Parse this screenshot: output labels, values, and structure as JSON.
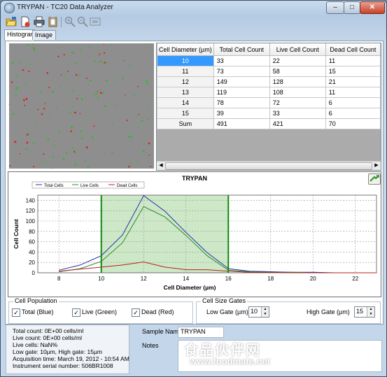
{
  "window": {
    "title": "TRYPAN - TC20 Data Analyzer"
  },
  "tabs": [
    {
      "label": "Histogram"
    },
    {
      "label": "Image"
    }
  ],
  "table": {
    "headers": [
      "Cell Diameter (µm)",
      "Total Cell Count",
      "Live Cell Count",
      "Dead Cell Count"
    ],
    "rows": [
      [
        "10",
        "33",
        "22",
        "11"
      ],
      [
        "11",
        "73",
        "58",
        "15"
      ],
      [
        "12",
        "149",
        "128",
        "21"
      ],
      [
        "13",
        "119",
        "108",
        "11"
      ],
      [
        "14",
        "78",
        "72",
        "6"
      ],
      [
        "15",
        "39",
        "33",
        "6"
      ],
      [
        "Sum",
        "491",
        "421",
        "70"
      ]
    ]
  },
  "chart_data": {
    "type": "line",
    "title": "TRYPAN",
    "xlabel": "Cell Diameter (µm)",
    "ylabel": "Cell Count",
    "xlim": [
      7,
      23
    ],
    "ylim": [
      0,
      150
    ],
    "xticks": [
      8,
      10,
      12,
      14,
      16,
      18,
      20,
      22
    ],
    "yticks": [
      0,
      20,
      40,
      60,
      80,
      100,
      120,
      140
    ],
    "x": [
      8,
      9,
      10,
      11,
      12,
      13,
      14,
      15,
      16,
      17,
      18,
      19,
      20,
      21,
      22,
      23
    ],
    "series": [
      {
        "name": "Total Cells",
        "color": "#1f2fa8",
        "values": [
          5,
          15,
          33,
          73,
          149,
          119,
          78,
          39,
          8,
          3,
          2,
          1,
          1,
          0,
          0,
          0
        ]
      },
      {
        "name": "Live Cells",
        "color": "#2b8a2b",
        "values": [
          2,
          8,
          22,
          58,
          128,
          108,
          72,
          33,
          5,
          2,
          1,
          1,
          0,
          0,
          0,
          0
        ]
      },
      {
        "name": "Dead Cells",
        "color": "#b42020",
        "values": [
          3,
          7,
          11,
          15,
          21,
          11,
          6,
          6,
          3,
          1,
          1,
          0,
          0,
          0,
          0,
          0
        ]
      }
    ],
    "gate_range": [
      10,
      16
    ],
    "grid": true,
    "legend_position": "top-left"
  },
  "cell_population": {
    "title": "Cell Population",
    "options": [
      {
        "label": "Total (Blue)",
        "checked": true
      },
      {
        "label": "Live (Green)",
        "checked": true
      },
      {
        "label": "Dead (Red)",
        "checked": true
      }
    ]
  },
  "cell_size_gates": {
    "title": "Cell Size Gates",
    "low_label": "Low Gate (µm)",
    "low_value": "10",
    "high_label": "High Gate (µm)",
    "high_value": "15"
  },
  "summary": [
    "Total count: 0E+00 cells/ml",
    "Live count: 0E+00 cells/ml",
    "Live cells: NaN%",
    "Low gate: 10µm, High gate: 15µm",
    "Acquisition time: March 19, 2012 - 10:54 AM",
    "Instrument serial number: 506BR1008"
  ],
  "sample": {
    "name_label": "Sample Name",
    "name_value": "TRYPAN",
    "notes_label": "Notes"
  },
  "watermark": {
    "line1": "食品伙伴网",
    "line2": "www.foodmate.net"
  }
}
